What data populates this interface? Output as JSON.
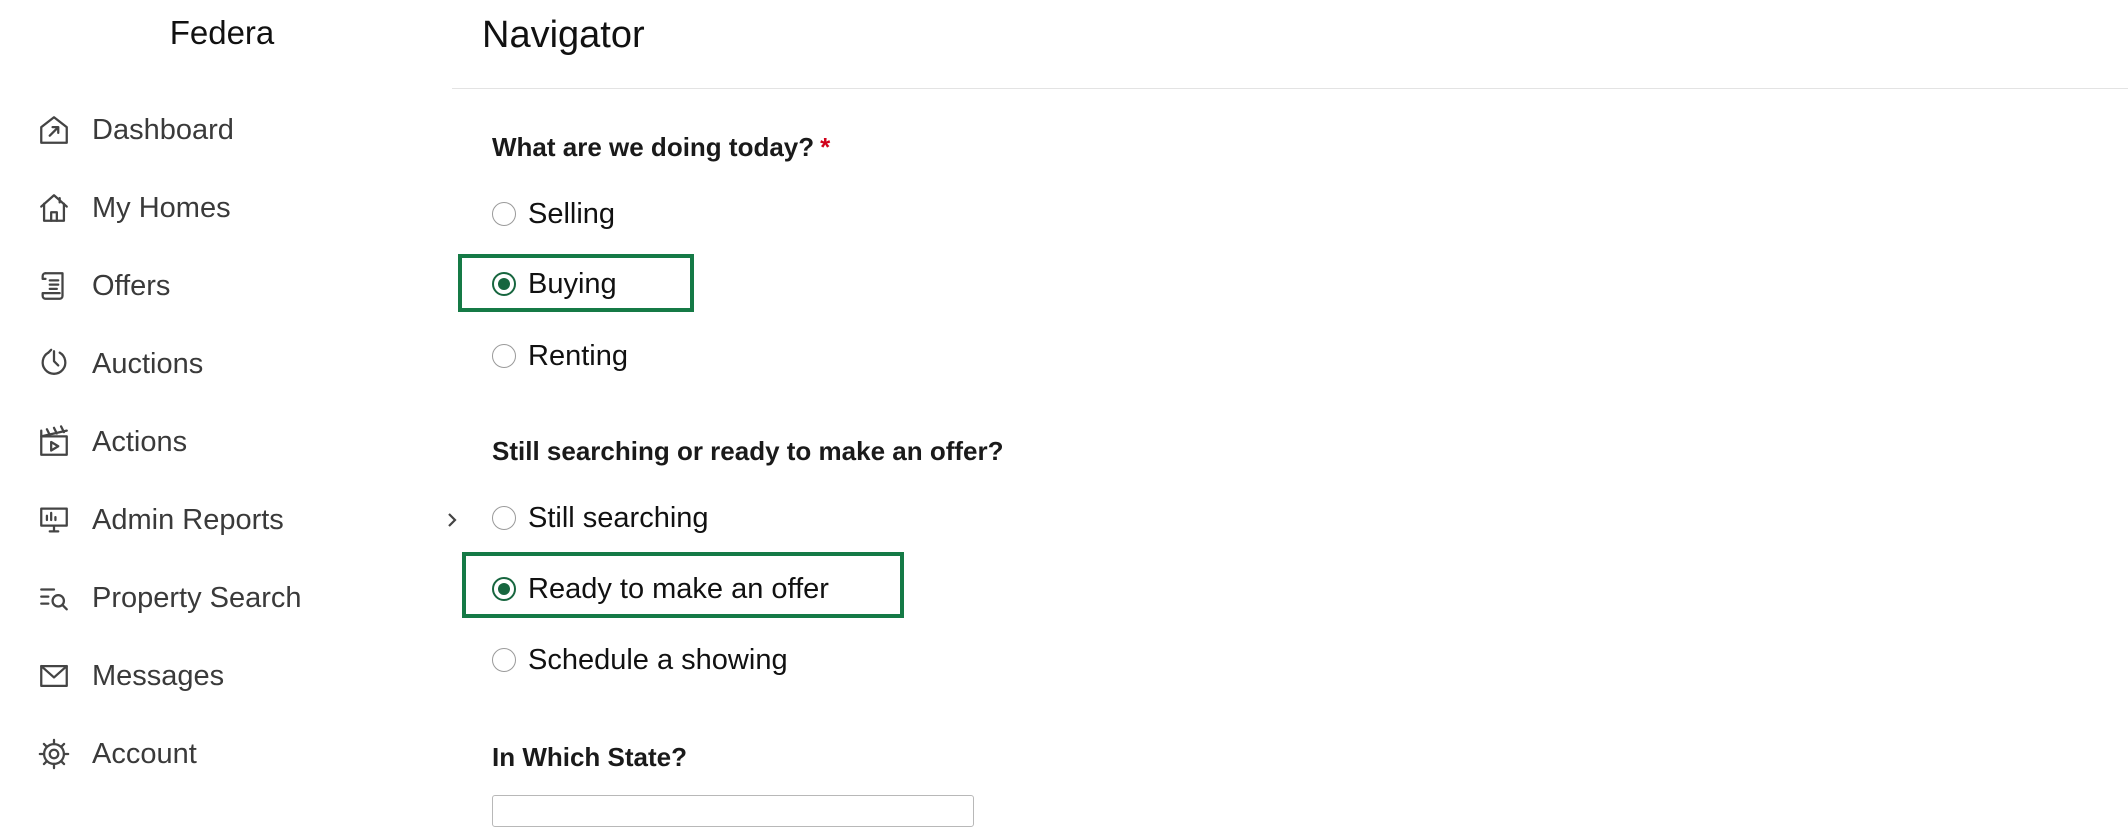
{
  "app": {
    "brand": "Federa"
  },
  "sidebar": {
    "items": [
      {
        "label": "Dashboard",
        "icon": "dashboard-icon"
      },
      {
        "label": "My Homes",
        "icon": "home-icon"
      },
      {
        "label": "Offers",
        "icon": "scroll-icon"
      },
      {
        "label": "Auctions",
        "icon": "gavel-icon"
      },
      {
        "label": "Actions",
        "icon": "clapperboard-icon"
      },
      {
        "label": "Admin Reports",
        "icon": "monitor-icon",
        "has_submenu": true
      },
      {
        "label": "Property Search",
        "icon": "search-list-icon"
      },
      {
        "label": "Messages",
        "icon": "envelope-icon"
      },
      {
        "label": "Account",
        "icon": "gear-icon"
      }
    ]
  },
  "main": {
    "title": "Navigator",
    "q1": {
      "label": "What are we doing today?",
      "required_mark": "*",
      "options": [
        "Selling",
        "Buying",
        "Renting"
      ],
      "selected": "Buying"
    },
    "q2": {
      "label": "Still searching or ready to make an offer?",
      "options": [
        "Still searching",
        "Ready to make an offer",
        "Schedule a showing"
      ],
      "selected": "Ready to make an offer"
    },
    "q3": {
      "label": "In Which State?",
      "value": ""
    }
  },
  "colors": {
    "accent": "#157a46",
    "required": "#d0021b",
    "divider": "#e3e3e3"
  }
}
